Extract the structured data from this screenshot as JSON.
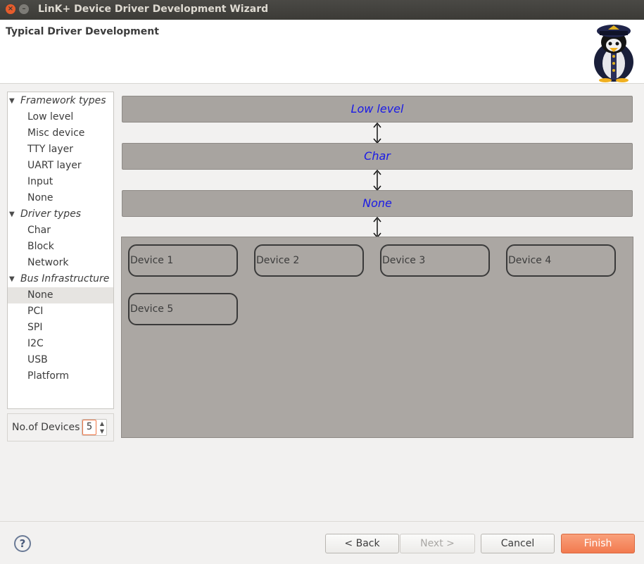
{
  "window": {
    "title": "LinK+ Device Driver Development Wizard"
  },
  "header": {
    "title": "Typical Driver Development",
    "logo_icon": "tux-pilot-penguin-logo"
  },
  "tree": [
    {
      "label": "Framework types",
      "group": true
    },
    {
      "label": "Low level"
    },
    {
      "label": "Misc device"
    },
    {
      "label": "TTY layer"
    },
    {
      "label": "UART layer"
    },
    {
      "label": "Input"
    },
    {
      "label": "None"
    },
    {
      "label": "Driver types",
      "group": true
    },
    {
      "label": "Char"
    },
    {
      "label": "Block"
    },
    {
      "label": "Network"
    },
    {
      "label": "Bus Infrastructure",
      "group": true
    },
    {
      "label": "None",
      "selected": true
    },
    {
      "label": "PCI"
    },
    {
      "label": "SPI"
    },
    {
      "label": "I2C"
    },
    {
      "label": "USB"
    },
    {
      "label": "Platform"
    }
  ],
  "devices_control": {
    "label": "No.of Devices",
    "value": "5"
  },
  "diagram": {
    "layers": [
      "Low level",
      "Char",
      "None"
    ],
    "devices": [
      "Device 1",
      "Device 2",
      "Device 3",
      "Device 4",
      "Device 5"
    ]
  },
  "buttons": {
    "help": "?",
    "back": "< Back",
    "next": "Next >",
    "cancel": "Cancel",
    "finish": "Finish"
  }
}
